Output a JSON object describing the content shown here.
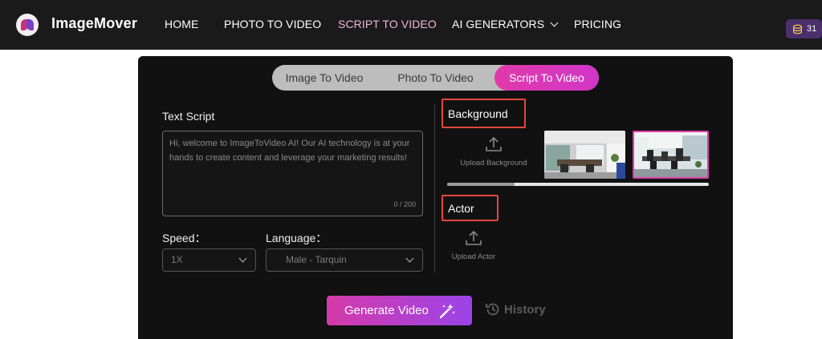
{
  "brand": {
    "name": "ImageMover"
  },
  "nav": {
    "links": [
      "HOME",
      "PHOTO TO VIDEO",
      "SCRIPT TO VIDEO",
      "AI GENERATORS",
      "PRICING"
    ],
    "active": "SCRIPT TO VIDEO"
  },
  "credits": {
    "count": "31",
    "icon": "coin-stack-icon"
  },
  "tabs": {
    "items": [
      "Image To Video",
      "Photo To Video",
      "Script To Video"
    ],
    "active": "Script To Video"
  },
  "script": {
    "label": "Text Script",
    "value": "Hi, welcome to ImageToVideo AI! Our AI technology is at your hands to create content and leverage your marketing results!",
    "counter": "0 / 200"
  },
  "speed": {
    "label": "Speed：",
    "value": "1X"
  },
  "language": {
    "label": "Language：",
    "value": "Male - Tarquin"
  },
  "background": {
    "label": "Background",
    "upload_label": "Upload Background",
    "thumbnails": [
      "office-photo",
      "office-photo-selected"
    ]
  },
  "actor": {
    "label": "Actor",
    "upload_label": "Upload Actor"
  },
  "actions": {
    "generate_label": "Generate Video",
    "history_label": "History"
  },
  "colors": {
    "accent_pink": "#e03aa9",
    "accent_purple": "#9a44e8",
    "highlight_box": "#e5483d",
    "nav_bg": "#1a1a1a",
    "panel_bg": "#111111"
  }
}
